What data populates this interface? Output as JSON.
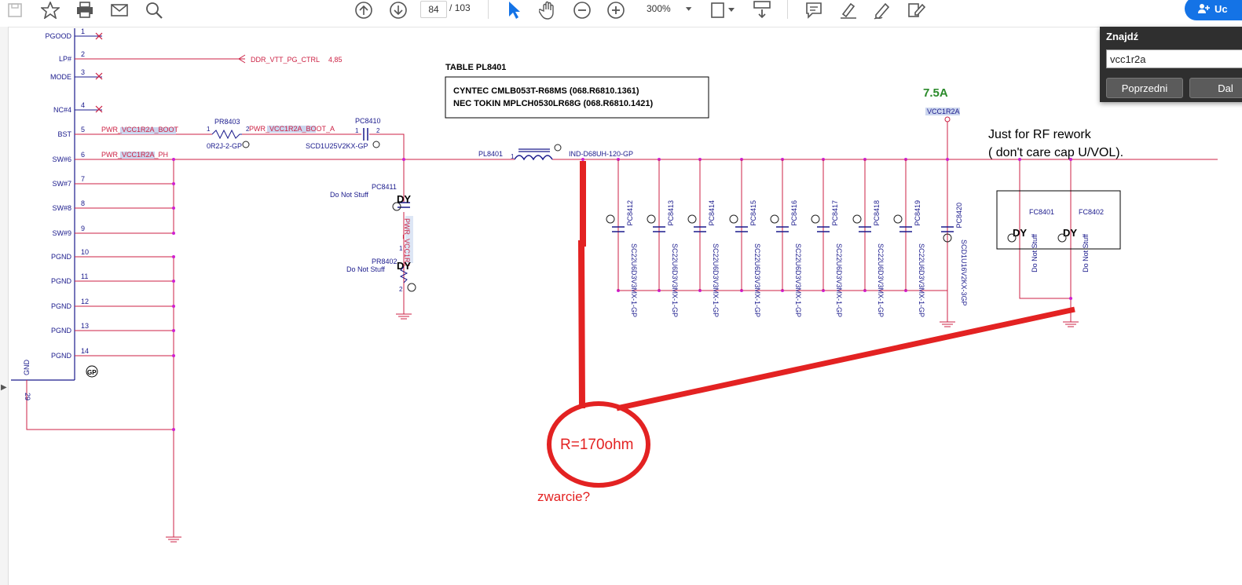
{
  "toolbar": {
    "page_current": "84",
    "page_sep": "/",
    "page_total": "103",
    "zoom": "300%",
    "sign_label": "Uc",
    "icons": [
      "save-icon",
      "bookmark-star-icon",
      "print-icon",
      "email-icon",
      "zoom-search-icon",
      "prev-page-icon",
      "next-page-icon",
      "select-cursor-icon",
      "hand-tool-icon",
      "zoom-out-icon",
      "zoom-in-icon",
      "page-fit-icon",
      "scroll-mode-icon",
      "comment-icon",
      "highlight-icon",
      "sign-pen-icon",
      "edit-pdf-icon"
    ]
  },
  "find": {
    "title": "Znajdź",
    "query": "vcc1r2a",
    "prev_label": "Poprzedni",
    "next_label": "Dal"
  },
  "schematic": {
    "table_title": "TABLE PL8401",
    "table_row1": "CYNTEC CMLB053T-R68MS     (068.R6810.1361)",
    "table_row2": "NEC TOKIN MPLCH0530LR68G (068.R6810.1421)",
    "current": "7.5A",
    "rail": "VCC1R2A",
    "rf_note1": "Just for RF rework",
    "rf_note2": "( don't care cap U/VOL).",
    "pins": [
      {
        "name": "PGOOD",
        "num": "1"
      },
      {
        "name": "LP#",
        "num": "2"
      },
      {
        "name": "MODE",
        "num": "3"
      },
      {
        "name": "NC#4",
        "num": "4"
      },
      {
        "name": "BST",
        "num": "5"
      },
      {
        "name": "SW#6",
        "num": "6"
      },
      {
        "name": "SW#7",
        "num": "7"
      },
      {
        "name": "SW#8",
        "num": "8"
      },
      {
        "name": "SW#9",
        "num": "9"
      },
      {
        "name": "PGND",
        "num": "10"
      },
      {
        "name": "PGND",
        "num": "11"
      },
      {
        "name": "PGND",
        "num": "12"
      },
      {
        "name": "PGND",
        "num": "13"
      },
      {
        "name": "PGND",
        "num": "14"
      }
    ],
    "gnd_label": "GND",
    "gnd_num": "29",
    "gp_mark": "GP",
    "ddr_net": "DDR_VTT_PG_CTRL",
    "ddr_ref": "4,85",
    "boot_net": "PWR_VCC1R2A_BOOT",
    "boot_net_a": "PWR_VCC1R2A_BOOT_A",
    "ph_net": "PWR_VCC1R2A_PH",
    "pr8403": "PR8403",
    "pr8403_val": "0R2J-2-GP",
    "pc8410": "PC8410",
    "pc8410_val": "SCD1U25V2KX-GP",
    "pl8401": "PL8401",
    "pl8401_val": "IND-D68UH-120-GP",
    "pc8411": "PC8411",
    "pr8402": "PR8402",
    "dns": "Do Not Stuff",
    "dy": "DY",
    "snubber_net": "PWR_VCC1R2",
    "caps": [
      "PC8412",
      "PC8413",
      "PC8414",
      "PC8415",
      "PC8416",
      "PC8417",
      "PC8418",
      "PC8419"
    ],
    "cap_val": "SC22U6D3V3MX-1-GP",
    "pc8420": "PC8420",
    "pc8420_val": "SCD1U16V2KX-3GP",
    "fc8401": "FC8401",
    "fc8402": "FC8402",
    "pin_one": "1",
    "pin_two": "2",
    "annotation_r": "R=170ohm",
    "annotation_q": "zwarcie?"
  }
}
